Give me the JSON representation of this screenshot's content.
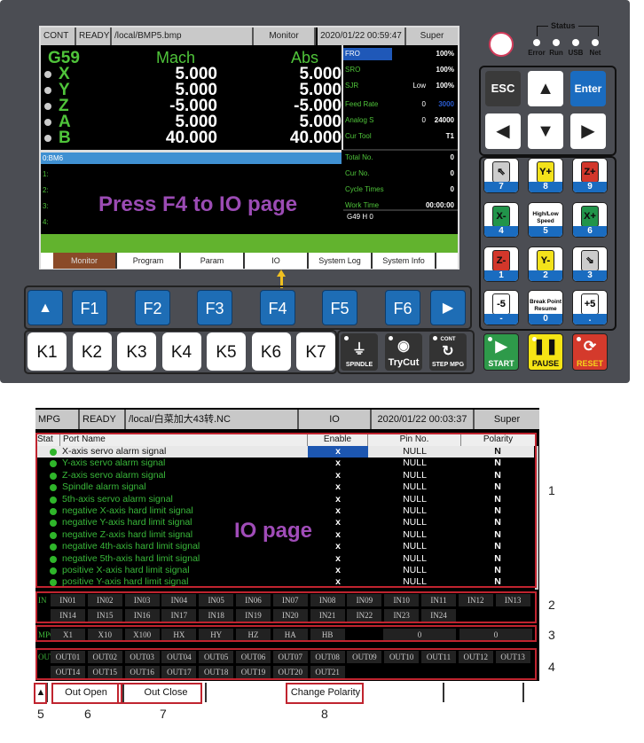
{
  "controller": {
    "status_bar": {
      "mode": "CONT",
      "state": "READY",
      "file": "/local/BMP5.bmp",
      "page": "Monitor",
      "datetime": "2020/01/22 00:59:47",
      "user": "Super"
    },
    "coords": {
      "wcs": "G59",
      "mach_label": "Mach",
      "abs_label": "Abs",
      "axes": [
        {
          "name": "X",
          "mach": "5.000",
          "abs": "5.000"
        },
        {
          "name": "Y",
          "mach": "5.000",
          "abs": "5.000"
        },
        {
          "name": "Z",
          "mach": "-5.000",
          "abs": "-5.000"
        },
        {
          "name": "A",
          "mach": "5.000",
          "abs": "5.000"
        },
        {
          "name": "B",
          "mach": "40.000",
          "abs": "40.000"
        }
      ]
    },
    "right_panel": [
      {
        "label": "FRO",
        "value": "100%"
      },
      {
        "label": "SRO",
        "value": "100%"
      },
      {
        "label": "SJR",
        "extra": "Low",
        "value": "100%"
      },
      {
        "label": "Feed Rate",
        "extra": "0",
        "value": "3000"
      },
      {
        "label": "Analog S",
        "extra": "0",
        "value": "24000"
      },
      {
        "label": "Cur Tool",
        "value": "T1"
      },
      {
        "label": "Total No.",
        "value": "0"
      },
      {
        "label": "Cur No.",
        "value": "0"
      },
      {
        "label": "Cycle Times",
        "value": "0"
      },
      {
        "label": "Work Time",
        "value": "00:00:00"
      }
    ],
    "gcode_state": "G49 H 0",
    "program_lines": [
      "0:BM6",
      "1:",
      "2:",
      "3:",
      "4:"
    ],
    "overlay_text": "Press F4 to IO page",
    "tabs": [
      "Monitor",
      "Program",
      "Param",
      "IO",
      "System Log",
      "System Info"
    ],
    "fkeys": [
      "▲",
      "F1",
      "F2",
      "F3",
      "F4",
      "F5",
      "F6",
      "▶"
    ],
    "kkeys": [
      "K1",
      "K2",
      "K3",
      "K4",
      "K5",
      "K6",
      "K7"
    ],
    "func_keys": [
      {
        "label": "SPINDLE",
        "icon": "⏚"
      },
      {
        "label": "TryCut",
        "icon": "◉"
      },
      {
        "label": "STEP MPG",
        "top": "CONT",
        "icon": "↻"
      }
    ],
    "cycle_keys": [
      {
        "label": "START",
        "icon": "▶",
        "color": "#2e9a4a"
      },
      {
        "label": "PAUSE",
        "icon": "❚❚",
        "color": "#f5e415"
      },
      {
        "label": "RESET",
        "icon": "⟳",
        "color": "#d43a2c"
      }
    ],
    "status_title": "Status",
    "status_leds": [
      "Error",
      "Run",
      "USB",
      "Net"
    ],
    "nav_keys": {
      "esc": "ESC",
      "up": "▲",
      "enter": "Enter",
      "left": "◀",
      "down": "▼",
      "right": "▶"
    },
    "num_keys": [
      {
        "num": "7",
        "sym": "⇖",
        "color": "#ccc"
      },
      {
        "num": "8",
        "sym": "Y+",
        "color": "#f3e21b"
      },
      {
        "num": "9",
        "sym": "Z+",
        "color": "#d2372b"
      },
      {
        "num": "4",
        "sym": "X-",
        "color": "#21944a"
      },
      {
        "num": "5",
        "text": "High/Low Speed"
      },
      {
        "num": "6",
        "sym": "X+",
        "color": "#21944a"
      },
      {
        "num": "1",
        "sym": "Z-",
        "color": "#d2372b"
      },
      {
        "num": "2",
        "sym": "Y-",
        "color": "#f3e21b"
      },
      {
        "num": "3",
        "sym": "⇘",
        "color": "#ccc"
      },
      {
        "num": "-",
        "sym": "-5",
        "color": "#fff"
      },
      {
        "num": "0",
        "text": "Break Point Resume"
      },
      {
        "num": ".",
        "sym": "+5",
        "color": "#fff"
      }
    ]
  },
  "io_page": {
    "status_bar": {
      "mode": "MPG",
      "state": "READY",
      "file": "/local/白菜加大43转.NC",
      "page": "IO",
      "datetime": "2020/01/22 00:03:37",
      "user": "Super"
    },
    "columns": [
      "Stat",
      "Port Name",
      "Enable",
      "Pin No.",
      "Polarity"
    ],
    "rows": [
      {
        "name": "X-axis servo alarm signal",
        "enable": "x",
        "pin": "NULL",
        "polarity": "N"
      },
      {
        "name": "Y-axis servo alarm signal",
        "enable": "x",
        "pin": "NULL",
        "polarity": "N"
      },
      {
        "name": "Z-axis servo alarm signal",
        "enable": "x",
        "pin": "NULL",
        "polarity": "N"
      },
      {
        "name": "Spindle alarm signal",
        "enable": "x",
        "pin": "NULL",
        "polarity": "N"
      },
      {
        "name": "5th-axis servo alarm signal",
        "enable": "x",
        "pin": "NULL",
        "polarity": "N"
      },
      {
        "name": "negative X-axis hard limit signal",
        "enable": "x",
        "pin": "NULL",
        "polarity": "N"
      },
      {
        "name": "negative Y-axis hard limit signal",
        "enable": "x",
        "pin": "NULL",
        "polarity": "N"
      },
      {
        "name": "negative Z-axis hard limit signal",
        "enable": "x",
        "pin": "NULL",
        "polarity": "N"
      },
      {
        "name": "negative 4th-axis hard limit signal",
        "enable": "x",
        "pin": "NULL",
        "polarity": "N"
      },
      {
        "name": "negative 5th-axis hard limit signal",
        "enable": "x",
        "pin": "NULL",
        "polarity": "N"
      },
      {
        "name": "positive X-axis hard limit signal",
        "enable": "x",
        "pin": "NULL",
        "polarity": "N"
      },
      {
        "name": "positive Y-axis hard limit signal",
        "enable": "x",
        "pin": "NULL",
        "polarity": "N"
      }
    ],
    "overlay_text": "IO page",
    "in_label": "IN",
    "inputs": [
      "IN01",
      "IN02",
      "IN03",
      "IN04",
      "IN05",
      "IN06",
      "IN07",
      "IN08",
      "IN09",
      "IN10",
      "IN11",
      "IN12",
      "IN13",
      "IN14",
      "IN15",
      "IN16",
      "IN17",
      "IN18",
      "IN19",
      "IN20",
      "IN21",
      "IN22",
      "IN23",
      "IN24"
    ],
    "mpg_label": "MPG",
    "mpg": [
      "X1",
      "X10",
      "X100",
      "HX",
      "HY",
      "HZ",
      "HA",
      "HB"
    ],
    "mpg_values": [
      "0",
      "0"
    ],
    "out_label": "OUT",
    "outputs": [
      "OUT01",
      "OUT02",
      "OUT03",
      "OUT04",
      "OUT05",
      "OUT06",
      "OUT07",
      "OUT08",
      "OUT09",
      "OUT10",
      "OUT11",
      "OUT12",
      "OUT13",
      "OUT14",
      "OUT15",
      "OUT16",
      "OUT17",
      "OUT18",
      "OUT19",
      "OUT20",
      "OUT21"
    ],
    "bottom_buttons": {
      "up": "▲",
      "out_open": "Out Open",
      "out_close": "Out Close",
      "change_polarity": "Change Polarity"
    },
    "annotations": [
      "1",
      "2",
      "3",
      "4",
      "5",
      "6",
      "7",
      "8"
    ]
  }
}
